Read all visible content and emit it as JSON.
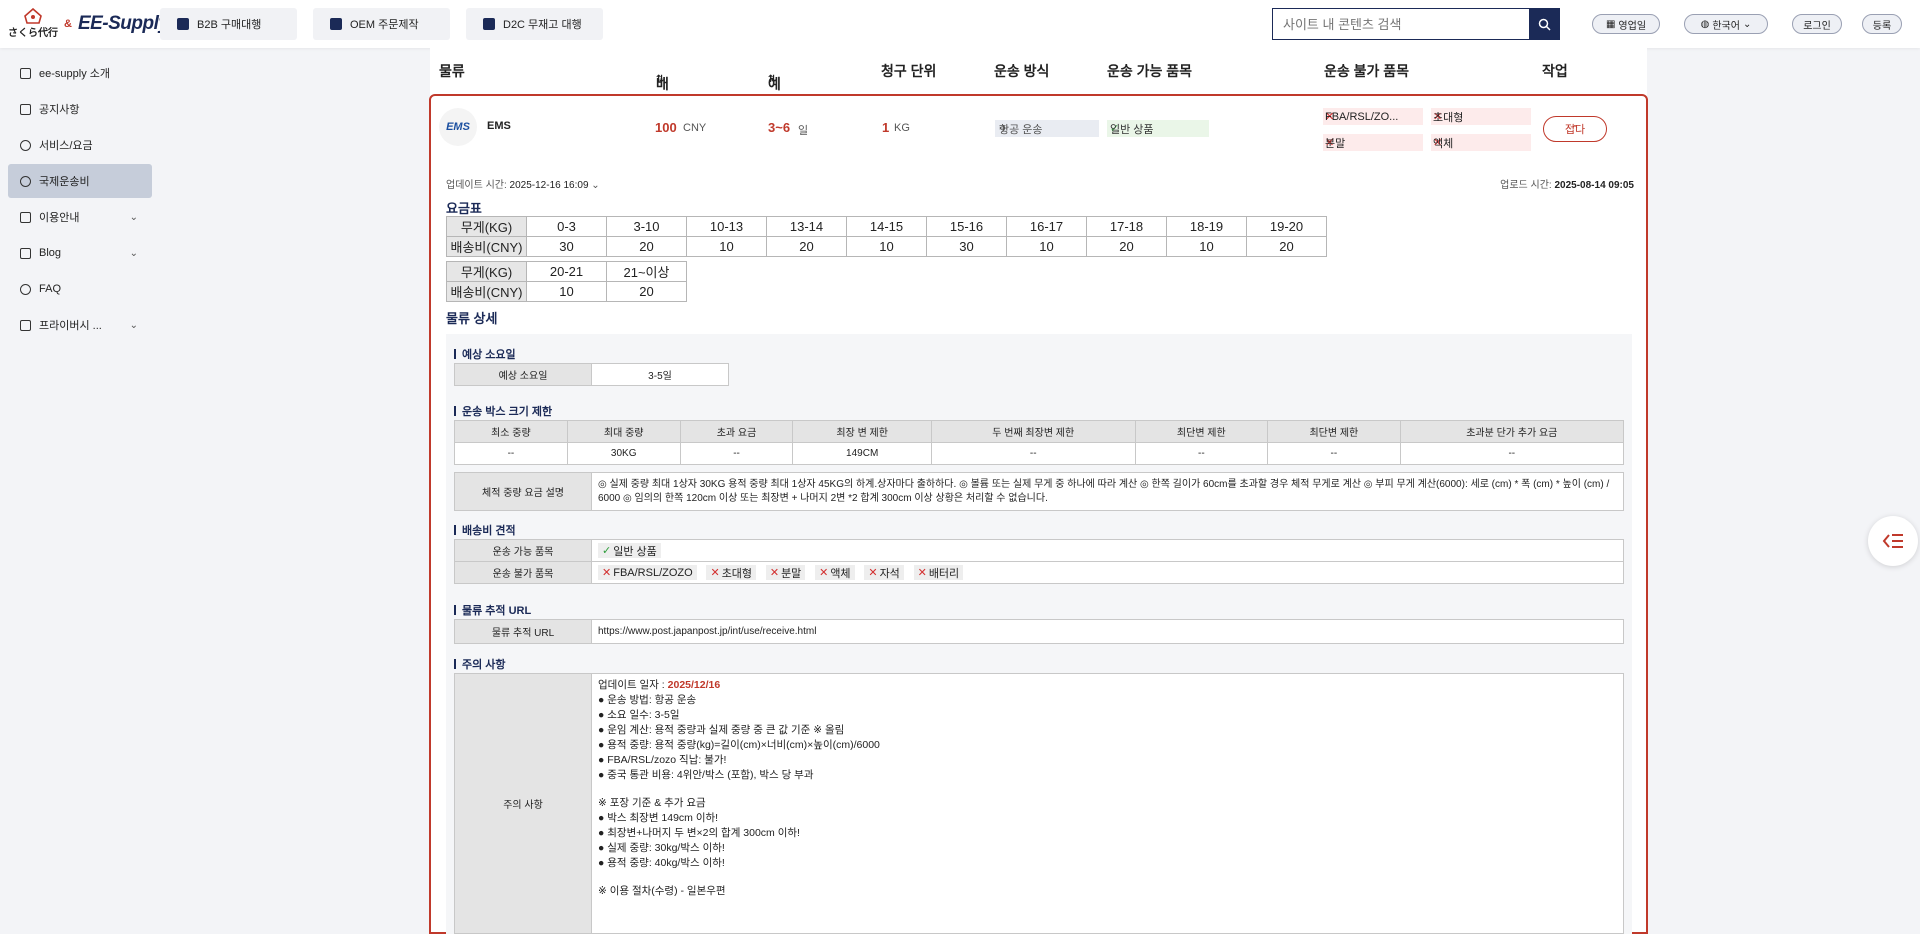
{
  "brand": {
    "left": "さくら代行",
    "amp": "&",
    "name": "EE-Supply"
  },
  "nav": {
    "b2b": "B2B 구매대행",
    "oem": "OEM 주문제작",
    "d2c": "D2C 무재고 대행"
  },
  "search": {
    "placeholder": "사이트 내 콘텐츠 검색"
  },
  "header": {
    "sales": "영업일",
    "language": "한국어",
    "login": "로그인",
    "register": "등록"
  },
  "sidebar": {
    "items": [
      {
        "label": "ee-supply 소개",
        "icon": "home-icon"
      },
      {
        "label": "공지사항",
        "icon": "megaphone-icon"
      },
      {
        "label": "서비스/요금",
        "icon": "coin-icon"
      },
      {
        "label": "국제운송비",
        "icon": "truck-icon"
      },
      {
        "label": "이용안내",
        "icon": "guide-icon"
      },
      {
        "label": "Blog",
        "icon": "blog-icon"
      },
      {
        "label": "FAQ",
        "icon": "faq-icon"
      },
      {
        "label": "프라이버시 ...",
        "icon": "privacy-icon"
      }
    ]
  },
  "columns": {
    "logistics": "물류",
    "fee": "배송비",
    "days": "예상 소요일",
    "unit": "청구 단위",
    "method": "운송 방식",
    "allowed": "운송 가능 품목",
    "forbidden": "운송 불가 품목",
    "action": "작업"
  },
  "row": {
    "logo": "EMS",
    "name": "EMS",
    "fee": "100",
    "fee_unit": "CNY",
    "days": "3~6",
    "days_unit": "일",
    "unit": "1",
    "unit_suffix": "KG",
    "method": "항공 운송",
    "allowed": "일반 상품",
    "forbidden": [
      "FBA/RSL/ZO...",
      "초대형",
      "분말",
      "액체"
    ],
    "collapse": "접다"
  },
  "detail": {
    "update_label": "업데이트 시간:",
    "update_value": "2025-12-16 16:09",
    "upload_label": "업로드 시간:",
    "upload_value": "2025-08-14 09:05",
    "rate_title": "요금표",
    "rate_weight_label": "무게(KG)",
    "rate_fee_label": "배송비(CNY)",
    "rate1": {
      "weights": [
        "0-3",
        "3-10",
        "10-13",
        "13-14",
        "14-15",
        "15-16",
        "16-17",
        "17-18",
        "18-19",
        "19-20"
      ],
      "fees": [
        "30",
        "20",
        "10",
        "20",
        "10",
        "30",
        "10",
        "20",
        "10",
        "20"
      ]
    },
    "rate2": {
      "weights": [
        "20-21",
        "21~이상"
      ],
      "fees": [
        "10",
        "20"
      ]
    },
    "logistics_title": "물류 상세",
    "eta_title": "예상 소요일",
    "eta_label": "예상 소요일",
    "eta_value": "3-5일",
    "box_title": "운송 박스 크기 제한",
    "box_headers": [
      "최소 중량",
      "최대 중량",
      "초과 요금",
      "최장 변 제한",
      "두 번째 최장변 제한",
      "최단변 제한",
      "최단변 제한",
      "초과분 단가 추가 요금"
    ],
    "box_values": [
      "--",
      "30KG",
      "--",
      "149CM",
      "--",
      "--",
      "--",
      "--"
    ],
    "volume_label": "체적 중량 요금 설명",
    "volume_text": "◎ 실제 중량 최대 1상자 30KG 용적 중량 최대 1상자 45KG의 하계.상자마다 출하하다. ◎ 볼륨 또는 실제 무게 중 하나에 따라 계산 ◎ 한쪽 길이가 60cm를 초과할 경우 체적 무게로 계산 ◎ 부피 무게 계산(6000): 세로 (cm) * 폭 (cm) * 높이 (cm) / 6000 ◎ 임의의 한쪽 120cm 이상 또는 최장변 + 나머지 2변 *2 합계 300cm 이상 상황은 처리할 수 없습니다.",
    "quote_title": "배송비 견적",
    "allowed_label": "운송 가능 품목",
    "allowed_items": [
      "일반 상품"
    ],
    "forbidden_label": "운송 불가 품목",
    "forbidden_items": [
      "FBA/RSL/ZOZO",
      "초대형",
      "분말",
      "액체",
      "자석",
      "배터리"
    ],
    "tracking_title": "물류 추적 URL",
    "tracking_label": "물류 추적 URL",
    "tracking_url": "https://www.post.japanpost.jp/int/use/receive.html",
    "notes_title": "주의 사항",
    "notes_label": "주의 사항",
    "notes_date_label": "업데이트 일자 :",
    "notes_date": "2025/12/16",
    "notes_lines": [
      "● 운송 방법: 항공 운송",
      "● 소요 일수: 3-5일",
      "● 운임 계산: 용적 중량과 실제 중량 중 큰 값 기준 ※ 올림",
      "● 용적 중량: 용적 중량(kg)=길이(cm)×너비(cm)×높이(cm)/6000",
      "● FBA/RSL/zozo 직납: 불가!",
      "● 중국 통관 비용: 4위안/박스 (포함), 박스 당 부과"
    ],
    "notes_lines2": [
      "※ 포장 기준 & 추가 요금",
      "● 박스 최장변 149cm 이하!",
      "● 최장변+나머지 두 변×2의 합계 300cm 이하!",
      "● 실제 중량: 30kg/박스 이하!",
      "● 용적 중량: 40kg/박스 이하!"
    ],
    "notes_lines3": [
      "※ 이용 절차(수령) - 일본우편"
    ]
  },
  "colors": {
    "accent": "#c0392b",
    "navy": "#1b2a57"
  }
}
